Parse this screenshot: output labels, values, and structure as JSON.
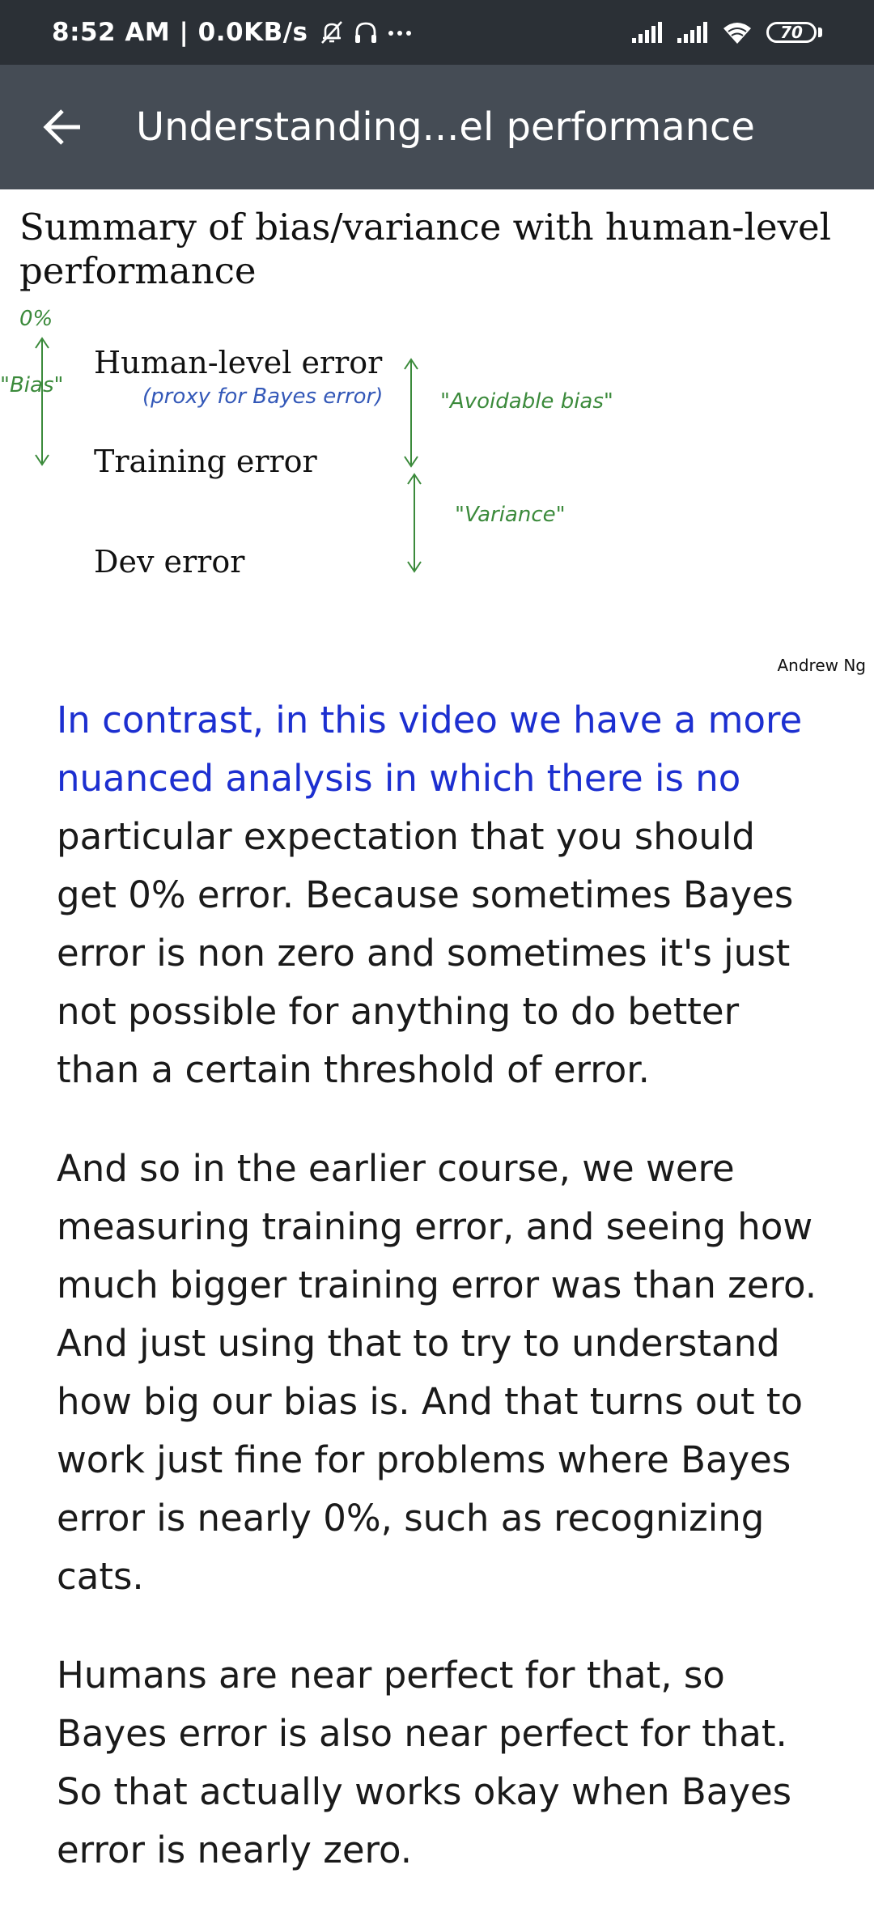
{
  "status_bar": {
    "time": "8:52 AM | 0.0KB/s",
    "battery": "70"
  },
  "app_bar": {
    "title": "Understanding...el performance"
  },
  "slide": {
    "title": "Summary of bias/variance with human-level performance",
    "labels": {
      "human_level_error": "Human-level error",
      "proxy_note": "(proxy for Bayes error)",
      "training_error": "Training error",
      "dev_error": "Dev error"
    },
    "annotations": {
      "zero_percent": "0%",
      "bias": "\"Bias\"",
      "avoidable_bias": "\"Avoidable bias\"",
      "variance": "\"Variance\""
    },
    "credit": "Andrew Ng"
  },
  "transcript": {
    "p1_highlight": "In contrast, in this video we have a more nuanced analysis in which there is no",
    "p1_rest": "particular expectation that you should get 0% error. Because sometimes Bayes error is non zero and sometimes it's just not possible for anything to do better than a certain threshold of error.",
    "p2": "And so in the earlier course, we were measuring training error, and seeing how much bigger training error was than zero. And just using that to try to understand how big our bias is. And that turns out to work just fine for problems where Bayes error is nearly 0%, such as recognizing cats.",
    "p3": "Humans are near perfect for that, so Bayes error is also near perfect for that. So that actually works okay when Bayes error is nearly zero."
  },
  "colors": {
    "status_bar_bg": "#2b3036",
    "app_bar_bg": "#454c55",
    "highlight_text": "#1c2fd0",
    "annotation_green": "#3b8a3b",
    "annotation_blue": "#3358b8"
  }
}
